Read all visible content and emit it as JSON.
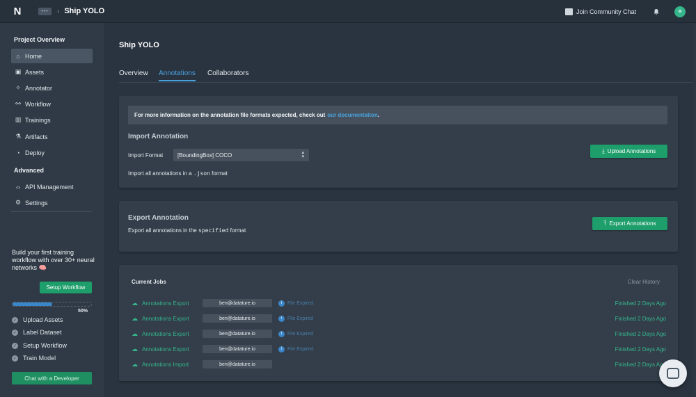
{
  "topbar": {
    "logo": "N",
    "project_box": "•••",
    "separator": "›",
    "project_title": "Ship YOLO",
    "community_label": "Join Community Chat",
    "avatar_glyph": "✳"
  },
  "sidebar": {
    "section_project": "Project Overview",
    "items": [
      {
        "label": "Home",
        "icon": "home-icon",
        "glyph": "⌂"
      },
      {
        "label": "Assets",
        "icon": "image-icon",
        "glyph": "▣"
      },
      {
        "label": "Annotator",
        "icon": "annotator-icon",
        "glyph": "✧"
      },
      {
        "label": "Workflow",
        "icon": "workflow-icon",
        "glyph": "⚯"
      },
      {
        "label": "Trainings",
        "icon": "chart-icon",
        "glyph": "▥"
      },
      {
        "label": "Artifacts",
        "icon": "artifact-icon",
        "glyph": "⚗"
      },
      {
        "label": "Deploy",
        "icon": "deploy-icon",
        "glyph": "◔"
      }
    ],
    "section_advanced": "Advanced",
    "advanced_items": [
      {
        "label": "API Management",
        "icon": "code-icon",
        "glyph": "‹›"
      },
      {
        "label": "Settings",
        "icon": "gear-icon",
        "glyph": "⚙"
      }
    ],
    "promo": "Build your first training workflow with over 30+ neural networks 🧠",
    "setup_button": "Setup Workflow",
    "progress_percent": 50,
    "progress_label": "50%",
    "checklist": [
      {
        "label": "Upload Assets",
        "done": true
      },
      {
        "label": "Label Dataset",
        "done": true
      },
      {
        "label": "Setup Workflow",
        "done": true
      },
      {
        "label": "Train Model",
        "done": false
      }
    ],
    "chat_button": "Chat with a Developer"
  },
  "main": {
    "page_title": "Ship YOLO",
    "tabs": [
      {
        "label": "Overview",
        "active": false
      },
      {
        "label": "Annotations",
        "active": true
      },
      {
        "label": "Collaborators",
        "active": false
      }
    ],
    "info": {
      "text": "For more information on the annotation file formats expected, check out",
      "link": "our documentation",
      "end": "."
    },
    "import": {
      "heading": "Import Annotation",
      "format_label": "Import Format",
      "format_value": "[BoundingBox] COCO",
      "desc_prefix": "Import all annotations in a",
      "desc_code": ".json",
      "desc_suffix": "format",
      "button": "Upload Annotations"
    },
    "export": {
      "heading": "Export Annotation",
      "desc_prefix": "Export all annotations in the",
      "desc_code": "specified",
      "desc_suffix": "format",
      "button": "Export Annotations"
    },
    "jobs": {
      "heading": "Current Jobs",
      "clear": "Clear History",
      "rows": [
        {
          "name": "Annotations Export",
          "email": "ben@datature.io",
          "status": "File Expired",
          "time": "Finished 2 Days Ago"
        },
        {
          "name": "Annotations Export",
          "email": "ben@datature.io",
          "status": "File Expired",
          "time": "Finished 2 Days Ago"
        },
        {
          "name": "Annotations Export",
          "email": "ben@datature.io",
          "status": "File Expired",
          "time": "Finished 2 Days Ago"
        },
        {
          "name": "Annotations Export",
          "email": "ben@datature.io",
          "status": "File Expired",
          "time": "Finished 2 Days Ago"
        },
        {
          "name": "Annotations Import",
          "email": "ben@datature.io",
          "status": "",
          "time": "Finished 2 Days Ago"
        }
      ]
    }
  },
  "colors": {
    "accent": "#4aa3df",
    "success": "#1e9e6b",
    "background": "#2a3440"
  }
}
